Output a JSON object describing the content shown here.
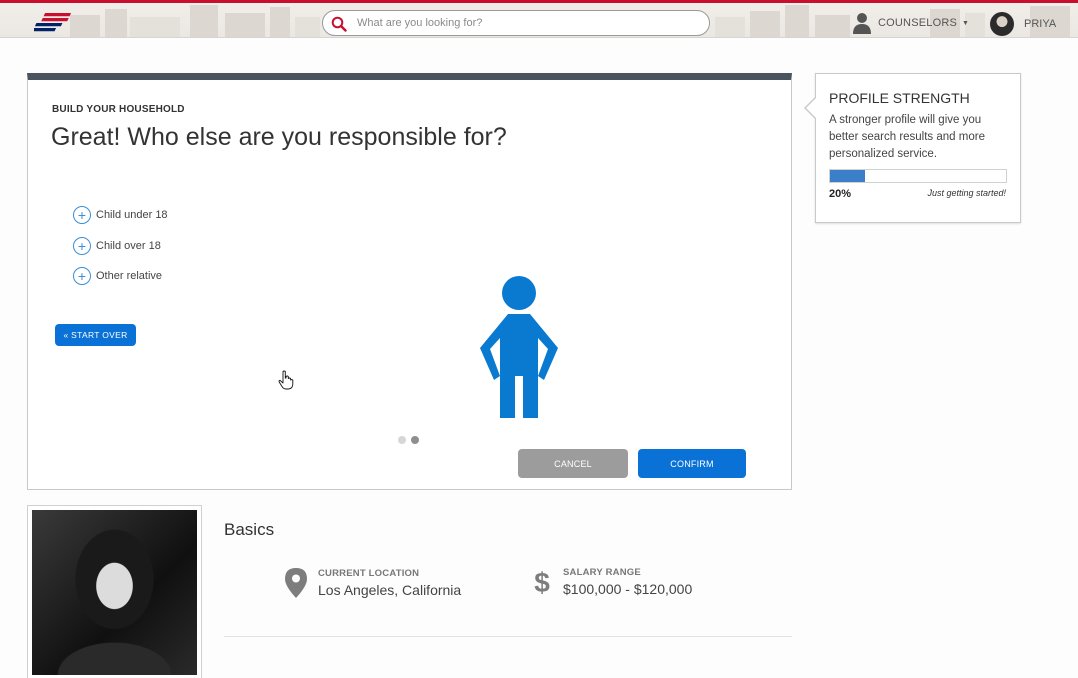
{
  "header": {
    "search_placeholder": "What are you looking for?",
    "counselors_label": "COUNSELORS",
    "user_name": "PRIYA"
  },
  "household": {
    "eyebrow": "BUILD YOUR HOUSEHOLD",
    "question": "Great! Who else are you responsible for?",
    "options": [
      {
        "label": "Child under 18"
      },
      {
        "label": "Child over 18"
      },
      {
        "label": "Other relative"
      }
    ],
    "start_over_label": "« START OVER",
    "cancel_label": "CANCEL",
    "confirm_label": "CONFIRM",
    "pager": {
      "count": 2,
      "active": 2
    }
  },
  "profile_strength": {
    "title": "PROFILE STRENGTH",
    "description": "A stronger profile will give you better search results and more personalized service.",
    "percent_value": 20,
    "percent_label": "20%",
    "status": "Just getting started!"
  },
  "basics": {
    "title": "Basics",
    "location_label": "CURRENT LOCATION",
    "location_value": "Los Angeles, California",
    "salary_label": "SALARY RANGE",
    "salary_value": "$100,000 - $120,000"
  },
  "colors": {
    "brand_red": "#c8102e",
    "brand_navy": "#012169",
    "accent_blue": "#0a72d6",
    "figure_blue": "#0a7ad1",
    "progress_blue": "#3b7fc9",
    "header_bar": "#4a545e"
  },
  "icons": {
    "logo": "bank-flag-logo",
    "search": "magnifier-icon",
    "counselors": "person-silhouette-icon",
    "add": "plus-circle-icon",
    "location": "map-pin-icon",
    "salary": "dollar-sign-icon",
    "cursor": "hand-pointer-icon"
  }
}
